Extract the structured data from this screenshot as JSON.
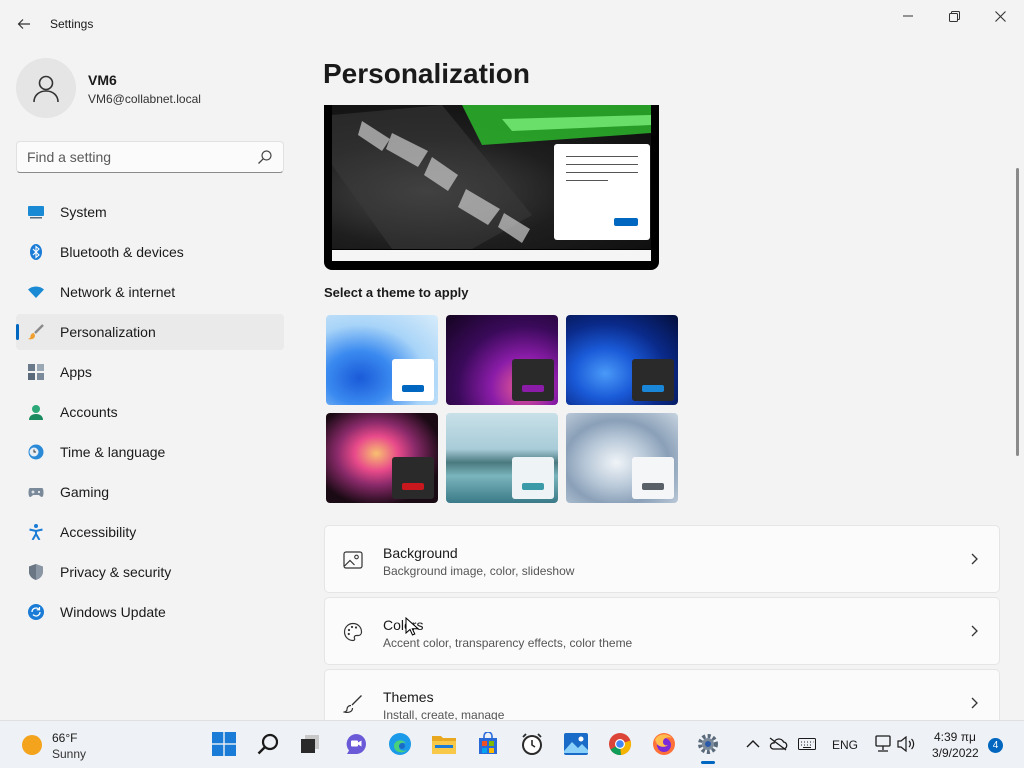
{
  "window": {
    "title": "Settings",
    "back_icon": "arrow-left-icon",
    "controls": [
      "minimize-icon",
      "restore-icon",
      "close-icon"
    ]
  },
  "user": {
    "name": "VM6",
    "email": "VM6@collabnet.local"
  },
  "search": {
    "placeholder": "Find a setting",
    "value": ""
  },
  "sidebar": {
    "items": [
      {
        "label": "System",
        "icon": "monitor-icon",
        "active": false
      },
      {
        "label": "Bluetooth & devices",
        "icon": "bluetooth-icon",
        "active": false
      },
      {
        "label": "Network & internet",
        "icon": "wifi-icon",
        "active": false
      },
      {
        "label": "Personalization",
        "icon": "brush-icon",
        "active": true
      },
      {
        "label": "Apps",
        "icon": "apps-icon",
        "active": false
      },
      {
        "label": "Accounts",
        "icon": "person-icon",
        "active": false
      },
      {
        "label": "Time & language",
        "icon": "clock-globe-icon",
        "active": false
      },
      {
        "label": "Gaming",
        "icon": "gamepad-icon",
        "active": false
      },
      {
        "label": "Accessibility",
        "icon": "accessibility-icon",
        "active": false
      },
      {
        "label": "Privacy & security",
        "icon": "shield-icon",
        "active": false
      },
      {
        "label": "Windows Update",
        "icon": "update-icon",
        "active": false
      }
    ]
  },
  "main": {
    "title": "Personalization",
    "themes_label": "Select a theme to apply",
    "themes": [
      {
        "name": "theme-windows-light",
        "accent": "#0067c0"
      },
      {
        "name": "theme-glow",
        "accent": "#8a1ca8"
      },
      {
        "name": "theme-windows-dark",
        "accent": "#1a86d8"
      },
      {
        "name": "theme-captured-motion",
        "accent": "#c8181e"
      },
      {
        "name": "theme-sunrise-lake",
        "accent": "#3a9aa8"
      },
      {
        "name": "theme-flow",
        "accent": "#5a6068"
      }
    ],
    "cards": [
      {
        "title": "Background",
        "subtitle": "Background image, color, slideshow",
        "icon": "image-icon"
      },
      {
        "title": "Colors",
        "subtitle": "Accent color, transparency effects, color theme",
        "icon": "palette-icon"
      },
      {
        "title": "Themes",
        "subtitle": "Install, create, manage",
        "icon": "brush-icon"
      }
    ]
  },
  "taskbar": {
    "weather": {
      "temp": "66°F",
      "condition": "Sunny",
      "icon": "sun-icon"
    },
    "apps": [
      "start-icon",
      "search-icon",
      "task-view-icon",
      "chat-icon",
      "edge-icon",
      "file-explorer-icon",
      "store-icon",
      "clock-app-icon",
      "photos-icon",
      "chrome-icon",
      "firefox-icon",
      "settings-icon"
    ],
    "tray": {
      "language": "ENG",
      "time": "4:39 πμ",
      "date": "3/9/2022",
      "notifications": "4"
    }
  },
  "colors": {
    "accent": "#0067c0",
    "background": "#f3f3f3",
    "card": "#fbfbfb"
  }
}
